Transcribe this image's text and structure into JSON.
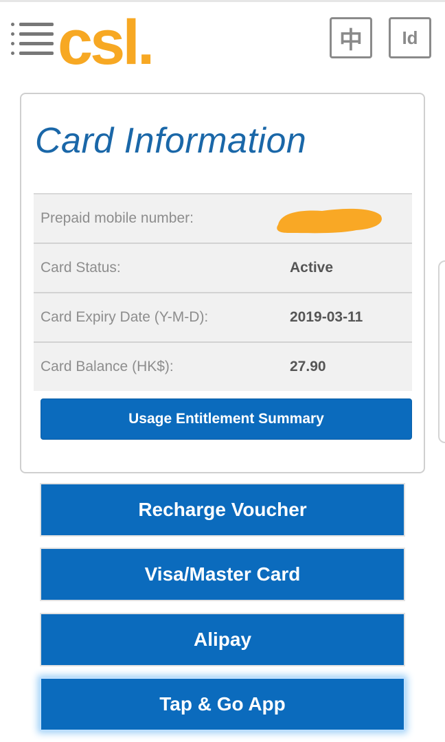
{
  "header": {
    "logo_text": "csl.",
    "lang_zh_label": "中",
    "lang_id_label": "Id",
    "menu_icon": "hamburger-menu-icon",
    "brand_color": "#f7a823"
  },
  "card_info": {
    "title": "Card Information",
    "rows": [
      {
        "label": "Prepaid mobile number:",
        "value": ""
      },
      {
        "label": "Card Status:",
        "value": "Active"
      },
      {
        "label": "Card Expiry Date (Y-M-D):",
        "value": "2019-03-11"
      },
      {
        "label": "Card Balance (HK$):",
        "value": "27.90"
      }
    ],
    "usage_button_label": "Usage Entitlement Summary",
    "title_color": "#1a67a8"
  },
  "payment_options": [
    {
      "label": "Recharge Voucher"
    },
    {
      "label": "Visa/Master Card"
    },
    {
      "label": "Alipay"
    },
    {
      "label": "Tap & Go App"
    }
  ],
  "colors": {
    "button_blue": "#0b6bbd",
    "redaction_orange": "#f9a825"
  }
}
